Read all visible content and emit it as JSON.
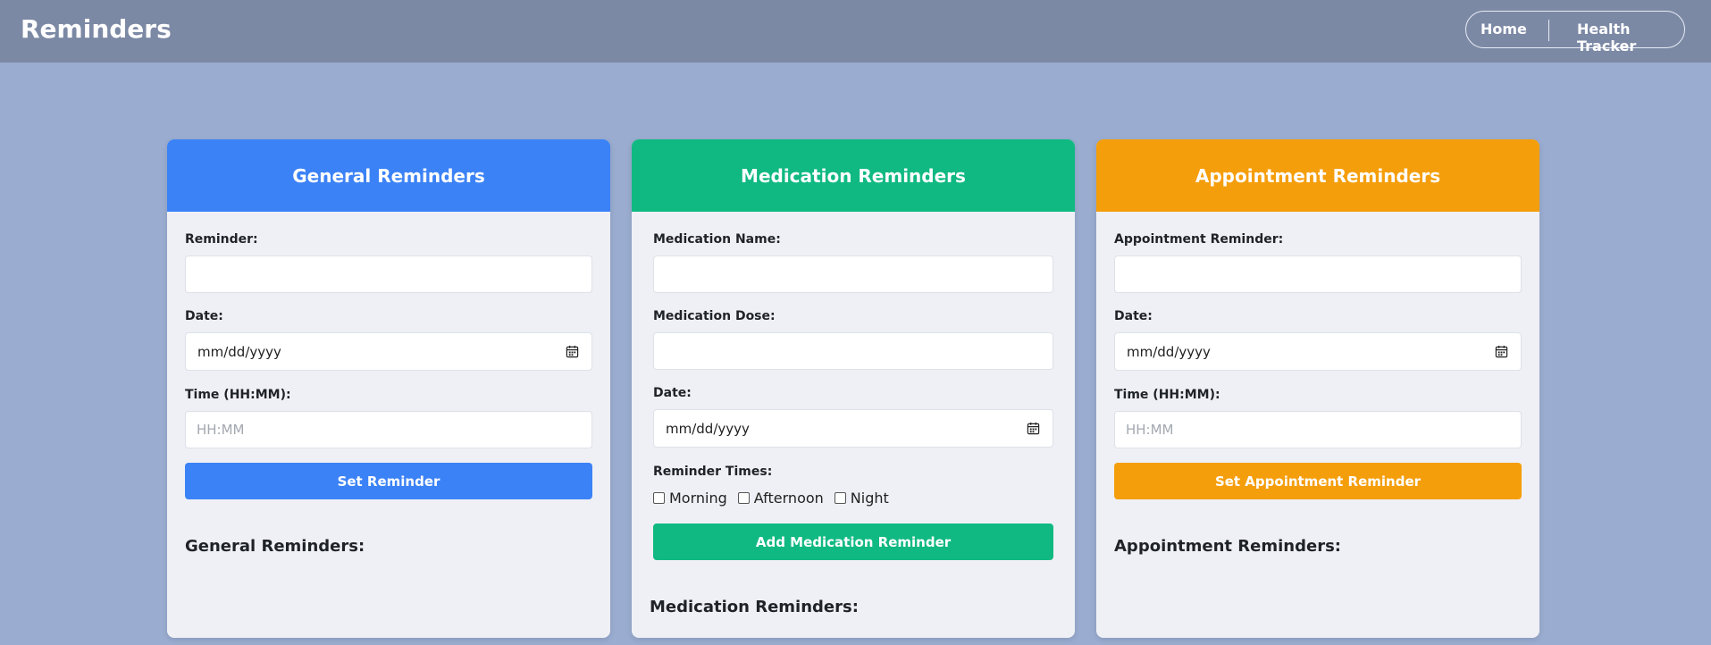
{
  "header": {
    "title": "Reminders",
    "nav": {
      "home": "Home",
      "health_tracker": "Health Tracker"
    }
  },
  "general": {
    "title": "General Reminders",
    "reminder_label": "Reminder:",
    "reminder_value": "",
    "date_label": "Date:",
    "date_placeholder": "mm/dd/yyyy",
    "time_label": "Time (HH:MM):",
    "time_placeholder": "HH:MM",
    "button": "Set Reminder",
    "list_heading": "General Reminders:"
  },
  "medication": {
    "title": "Medication Reminders",
    "name_label": "Medication Name:",
    "dose_label": "Medication Dose:",
    "date_label": "Date:",
    "date_placeholder": "mm/dd/yyyy",
    "times_label": "Reminder Times:",
    "times": [
      {
        "label": "Morning",
        "checked": false
      },
      {
        "label": "Afternoon",
        "checked": false
      },
      {
        "label": "Night",
        "checked": false
      }
    ],
    "button": "Add Medication Reminder",
    "list_heading": "Medication Reminders:"
  },
  "appointment": {
    "title": "Appointment Reminders",
    "reminder_label": "Appointment Reminder:",
    "date_label": "Date:",
    "date_placeholder": "mm/dd/yyyy",
    "time_label": "Time (HH:MM):",
    "time_placeholder": "HH:MM",
    "button": "Set Appointment Reminder",
    "list_heading": "Appointment Reminders:"
  },
  "colors": {
    "general_accent": "#3b82f6",
    "medication_accent": "#10b981",
    "appointment_accent": "#f59e0b",
    "page_background": "#9aaccf",
    "topbar_background": "#7c89a5"
  },
  "icons": {
    "date_picker": "calendar-icon"
  }
}
